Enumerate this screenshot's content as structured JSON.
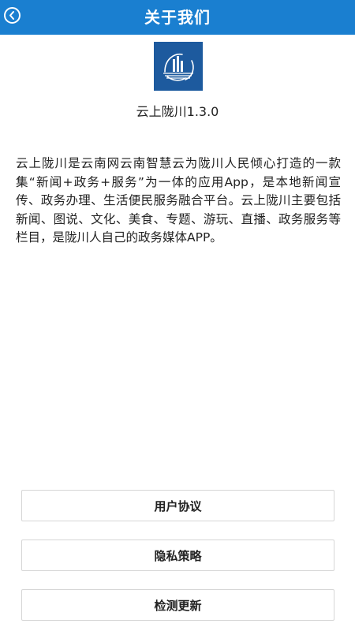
{
  "header": {
    "title": "关于我们",
    "back_icon": "chevron-left-circle-icon",
    "background_color": "#1a7fd0"
  },
  "app": {
    "logo_icon": "app-logo-icon",
    "version_label": "云上陇川1.3.0",
    "description": "云上陇川是云南网云南智慧云为陇川人民倾心打造的一款集“新闻+政务+服务”为一体的应用App，是本地新闻宣传、政务办理、生活便民服务融合平台。云上陇川主要包括新闻、图说、文化、美食、专题、游玩、直播、政务服务等栏目，是陇川人自己的政务媒体APP。"
  },
  "actions": {
    "user_agreement": "用户协议",
    "privacy_policy": "隐私策略",
    "check_update": "检测更新"
  }
}
